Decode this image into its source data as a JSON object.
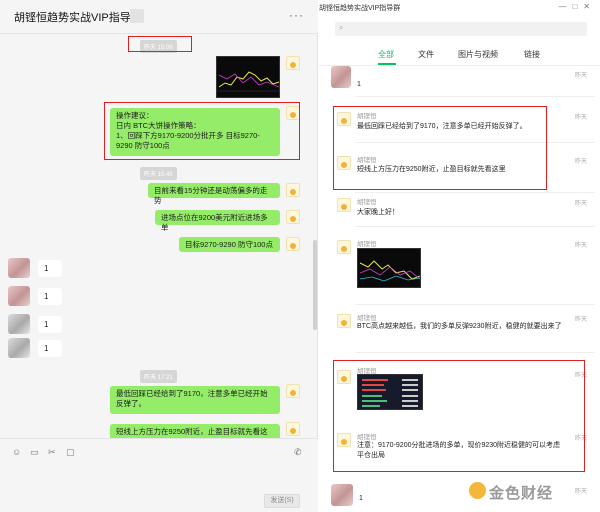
{
  "chat": {
    "title": "胡铿恒趋势实战VIP指导群",
    "more_icon": "ellipsis-icon",
    "timestamps": [
      "昨天 15:06",
      "昨天 15:45",
      "昨天 17:21"
    ],
    "messages": [
      {
        "text": "操作建议：\n日内 BTC大饼操作策略：\n1、回踩下方9170-9200分批开多 目标9270-9290 防守100点"
      },
      {
        "text": "目前来看15分钟还是动荡偏多的走势"
      },
      {
        "text": "进场点位在9200美元附近进场多单"
      },
      {
        "text": "目标9270-9290 防守100点"
      },
      {
        "text": "最低回踩已经给到了9170，注意多单已经开始反弹了。"
      },
      {
        "text": "短线上方压力在9250附近，止盈目标就先看这里"
      }
    ],
    "replies": [
      "1",
      "1",
      "1",
      "1",
      "1"
    ],
    "send_label": "发送(S)"
  },
  "history": {
    "window_title": "胡铿恒趋势实战VIP指导群",
    "search_placeholder": "",
    "tabs": [
      "全部",
      "文件",
      "图片与视频",
      "链接"
    ],
    "items": [
      {
        "name": "",
        "text": "1",
        "time": "昨天"
      },
      {
        "name": "胡铿恒",
        "text": "最低回踩已经给到了9170，注意多单已经开始反弹了。",
        "time": "昨天"
      },
      {
        "name": "胡铿恒",
        "text": "短线上方压力在9250附近，止盈目标就先看这里",
        "time": "昨天"
      },
      {
        "name": "胡铿恒",
        "text": "大家晚上好！",
        "time": "昨天"
      },
      {
        "name": "胡铿恒",
        "text": "",
        "time": "昨天"
      },
      {
        "name": "胡铿恒",
        "text": "BTC高点越来越低，我们的多单反弹9230附近，稳健的就要出来了",
        "time": "昨天"
      },
      {
        "name": "胡铿恒",
        "text": "",
        "time": "昨天"
      },
      {
        "name": "胡铿恒",
        "text": "注意：9170-9200分批进场的多单，现价9230附近稳健的可以考虑平仓出局",
        "time": "昨天"
      },
      {
        "name": "",
        "text": "1",
        "time": "昨天"
      }
    ]
  },
  "watermark": "金色财经",
  "colors": {
    "bubble_green": "#95ec69",
    "accent_green": "#07c160",
    "highlight_red": "#e02020"
  }
}
